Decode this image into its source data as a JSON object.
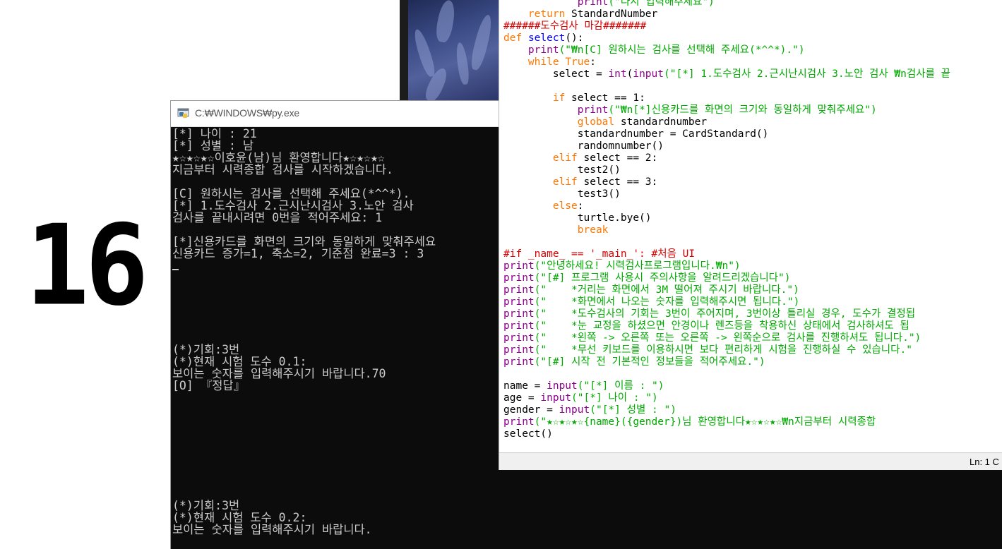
{
  "background_window": {
    "vision_number": "16"
  },
  "console": {
    "title": "C:₩WINDOWS₩py.exe",
    "lines": [
      "[*] 나이 : 21",
      "[*] 성별 : 남",
      "★☆★☆★☆이호윤(남)님 환영합니다★☆★☆★☆",
      "지금부터 시력종합 검사를 시작하겠습니다.",
      "",
      "[C] 원하시는 검사를 선택해 주세요(*^^*).",
      "[*] 1.도수검사 2.근시난시검사 3.노안 검사",
      "검사를 끝내시려면 0번을 적어주세요: 1",
      "",
      "[*]신용카드를 화면의 크기와 동일하게 맞춰주세요",
      "신용카드 증가=1, 축소=2, 기준점 완료=3 : 3",
      "",
      "",
      "",
      "",
      "",
      "",
      "",
      "(*)기회:3번",
      "(*)현재 시험 도수 0.1:",
      "보이는 숫자를 입력해주시기 바랍니다.70",
      "[O] 『정답』",
      "",
      "",
      "",
      "",
      "",
      "",
      "",
      "",
      "",
      "(*)기회:3번",
      "(*)현재 시험 도수 0.2:",
      "보이는 숫자를 입력해주시기 바랍니다."
    ]
  },
  "editor": {
    "status": "Ln: 1  C",
    "code": [
      [
        {
          "t": "            "
        },
        {
          "t": "print",
          "c": "bi"
        },
        {
          "t": "(\"다시 입력해주세요\")",
          "c": "st"
        }
      ],
      [
        {
          "t": "    "
        },
        {
          "t": "return",
          "c": "kw"
        },
        {
          "t": " StandardNumber"
        }
      ],
      [
        {
          "t": "######도수검사 마감#######",
          "c": "cm"
        }
      ],
      [
        {
          "t": "def",
          "c": "kw"
        },
        {
          "t": " "
        },
        {
          "t": "select",
          "c": "df"
        },
        {
          "t": "():"
        }
      ],
      [
        {
          "t": "    "
        },
        {
          "t": "print",
          "c": "bi"
        },
        {
          "t": "(\"₩n[C] 원하시는 검사를 선택해 주세요(*^^*).\")",
          "c": "st"
        }
      ],
      [
        {
          "t": "    "
        },
        {
          "t": "while",
          "c": "kw"
        },
        {
          "t": " "
        },
        {
          "t": "True",
          "c": "kw"
        },
        {
          "t": ":"
        }
      ],
      [
        {
          "t": "        select = "
        },
        {
          "t": "int",
          "c": "bi"
        },
        {
          "t": "("
        },
        {
          "t": "input",
          "c": "bi"
        },
        {
          "t": "(\"[*] 1.도수검사 2.근시난시검사 3.노안 검사 ₩n검사를 끝",
          "c": "st"
        }
      ],
      [
        {
          "t": ""
        }
      ],
      [
        {
          "t": "        "
        },
        {
          "t": "if",
          "c": "kw"
        },
        {
          "t": " select == 1:"
        }
      ],
      [
        {
          "t": "            "
        },
        {
          "t": "print",
          "c": "bi"
        },
        {
          "t": "(\"₩n[*]신용카드를 화면의 크기와 동일하게 맞춰주세요\")",
          "c": "st"
        }
      ],
      [
        {
          "t": "            "
        },
        {
          "t": "global",
          "c": "kw"
        },
        {
          "t": " standardnumber"
        }
      ],
      [
        {
          "t": "            standardnumber = CardStandard()"
        }
      ],
      [
        {
          "t": "            randomnumber()"
        }
      ],
      [
        {
          "t": "        "
        },
        {
          "t": "elif",
          "c": "kw"
        },
        {
          "t": " select == 2:"
        }
      ],
      [
        {
          "t": "            test2()"
        }
      ],
      [
        {
          "t": "        "
        },
        {
          "t": "elif",
          "c": "kw"
        },
        {
          "t": " select == 3:"
        }
      ],
      [
        {
          "t": "            test3()"
        }
      ],
      [
        {
          "t": "        "
        },
        {
          "t": "else",
          "c": "kw"
        },
        {
          "t": ":"
        }
      ],
      [
        {
          "t": "            turtle.bye()"
        }
      ],
      [
        {
          "t": "            "
        },
        {
          "t": "break",
          "c": "kw"
        }
      ],
      [
        {
          "t": ""
        }
      ],
      [
        {
          "t": "#if _name_ == '_main_': #처음 UI",
          "c": "cm"
        }
      ],
      [
        {
          "t": "print",
          "c": "bi"
        },
        {
          "t": "(\"안녕하세요! 시력검사프로그램입니다.₩n\")",
          "c": "st"
        }
      ],
      [
        {
          "t": "print",
          "c": "bi"
        },
        {
          "t": "(\"[#] 프로그램 사용시 주의사항을 알려드리겠습니다\")",
          "c": "st"
        }
      ],
      [
        {
          "t": "print",
          "c": "bi"
        },
        {
          "t": "(\"    *거리는 화면에서 3M 떨어져 주시기 바랍니다.\")",
          "c": "st"
        }
      ],
      [
        {
          "t": "print",
          "c": "bi"
        },
        {
          "t": "(\"    *화면에서 나오는 숫자를 입력해주시면 됩니다.\")",
          "c": "st"
        }
      ],
      [
        {
          "t": "print",
          "c": "bi"
        },
        {
          "t": "(\"    *도수검사의 기회는 3번이 주어지며, 3번이상 틀리실 경우, 도수가 결정됩",
          "c": "st"
        }
      ],
      [
        {
          "t": "print",
          "c": "bi"
        },
        {
          "t": "(\"    *눈 교정을 하셨으면 안경이나 렌즈등을 착용하신 상태에서 검사하셔도 됩",
          "c": "st"
        }
      ],
      [
        {
          "t": "print",
          "c": "bi"
        },
        {
          "t": "(\"    *왼쪽 -> 오른쪽 또는 오른쪽 -> 왼쪽순으로 검사를 진행하셔도 됩니다.\")",
          "c": "st"
        }
      ],
      [
        {
          "t": "print",
          "c": "bi"
        },
        {
          "t": "(\"    *무선 키보드를 이용하시면 보다 편리하게 시험을 진행하실 수 있습니다.\"",
          "c": "st"
        }
      ],
      [
        {
          "t": "print",
          "c": "bi"
        },
        {
          "t": "(\"[#] 시작 전 기본적인 정보들을 적어주세요.\")",
          "c": "st"
        }
      ],
      [
        {
          "t": ""
        }
      ],
      [
        {
          "t": "name = "
        },
        {
          "t": "input",
          "c": "bi"
        },
        {
          "t": "(\"[*] 이름 : \")",
          "c": "st"
        }
      ],
      [
        {
          "t": "age = "
        },
        {
          "t": "input",
          "c": "bi"
        },
        {
          "t": "(\"[*] 나이 : \")",
          "c": "st"
        }
      ],
      [
        {
          "t": "gender = "
        },
        {
          "t": "input",
          "c": "bi"
        },
        {
          "t": "(\"[*] 성별 : \")",
          "c": "st"
        }
      ],
      [
        {
          "t": "print",
          "c": "bi"
        },
        {
          "t": "(\"★☆★☆★☆{name}({gender})님 환영합니다★☆★☆★☆₩n지금부터 시력종합",
          "c": "st"
        }
      ],
      [
        {
          "t": "select()"
        }
      ]
    ]
  }
}
